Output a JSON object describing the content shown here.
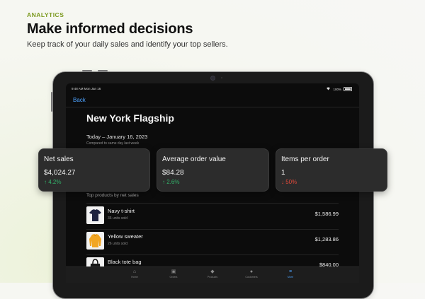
{
  "header": {
    "eyebrow": "ANALYTICS",
    "title": "Make informed decisions",
    "subtitle": "Keep track of your daily sales and identify your top sellers."
  },
  "status_bar": {
    "time": "9:48 AM  Mon Jan 16",
    "battery": "100%"
  },
  "nav": {
    "back_label": "Back"
  },
  "store": {
    "name": "New York Flagship",
    "date_range": "Today – January 16, 2023",
    "comparison": "Compared to same day last week"
  },
  "metrics": [
    {
      "label": "Net sales",
      "value": "$4,024.27",
      "delta_arrow": "↑",
      "delta": "4.2%",
      "trend": "up"
    },
    {
      "label": "Average order value",
      "value": "$84.28",
      "delta_arrow": "↑",
      "delta": "2.6%",
      "trend": "up"
    },
    {
      "label": "Items per order",
      "value": "1",
      "delta_arrow": "↓",
      "delta": "50%",
      "trend": "down"
    }
  ],
  "top_products": {
    "section_label": "Top products by net sales",
    "items": [
      {
        "name": "Navy t-shirt",
        "units": "36 units sold",
        "amount": "$1,586.99",
        "thumb_color": "#1e2340"
      },
      {
        "name": "Yellow sweater",
        "units": "26 units sold",
        "amount": "$1,283.86",
        "thumb_color": "#f2a623"
      },
      {
        "name": "Black tote bag",
        "units": "",
        "amount": "$840.00",
        "thumb_color": "#151515"
      }
    ]
  },
  "tab_bar": {
    "items": [
      {
        "label": "Home",
        "icon": "home-icon",
        "active": false
      },
      {
        "label": "Orders",
        "icon": "orders-icon",
        "active": false
      },
      {
        "label": "Products",
        "icon": "tag-icon",
        "active": false
      },
      {
        "label": "Customers",
        "icon": "person-icon",
        "active": false
      },
      {
        "label": "More",
        "icon": "menu-icon",
        "active": true
      }
    ]
  },
  "colors": {
    "accent": "#4da3ff",
    "positive": "#33b36b",
    "negative": "#e24a3b",
    "eyebrow": "#7c9a20"
  }
}
